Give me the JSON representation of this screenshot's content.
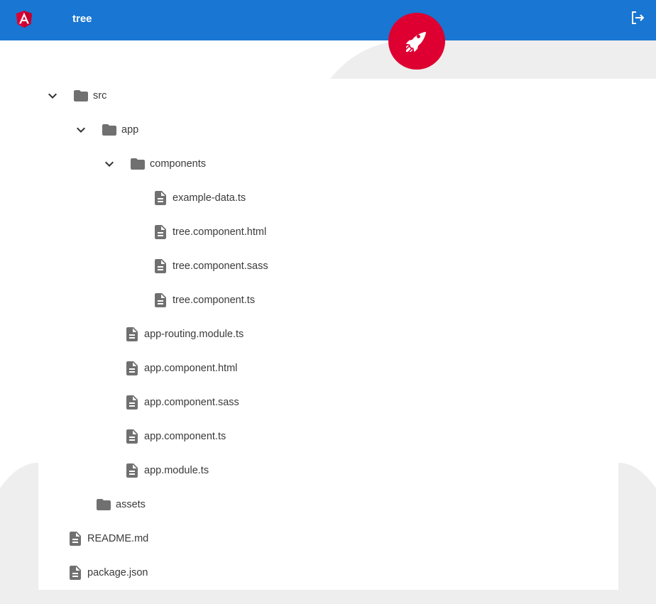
{
  "toolbar": {
    "title": "tree",
    "logo_icon": "angular-logo-icon",
    "logout_icon": "logout-icon",
    "color": "#1976d2"
  },
  "badge": {
    "icon": "rocket-icon",
    "color": "#dd0031"
  },
  "tree": [
    {
      "label": "src",
      "type": "folder",
      "expanded": true
    },
    {
      "label": "app",
      "type": "folder",
      "expanded": true
    },
    {
      "label": "components",
      "type": "folder",
      "expanded": true
    },
    {
      "label": "example-data.ts",
      "type": "file"
    },
    {
      "label": "tree.component.html",
      "type": "file"
    },
    {
      "label": "tree.component.sass",
      "type": "file"
    },
    {
      "label": "tree.component.ts",
      "type": "file"
    },
    {
      "label": "app-routing.module.ts",
      "type": "file"
    },
    {
      "label": "app.component.html",
      "type": "file"
    },
    {
      "label": "app.component.sass",
      "type": "file"
    },
    {
      "label": "app.component.ts",
      "type": "file"
    },
    {
      "label": "app.module.ts",
      "type": "file"
    },
    {
      "label": "assets",
      "type": "folder",
      "expanded": false
    },
    {
      "label": "README.md",
      "type": "file"
    },
    {
      "label": "package.json",
      "type": "file"
    }
  ]
}
